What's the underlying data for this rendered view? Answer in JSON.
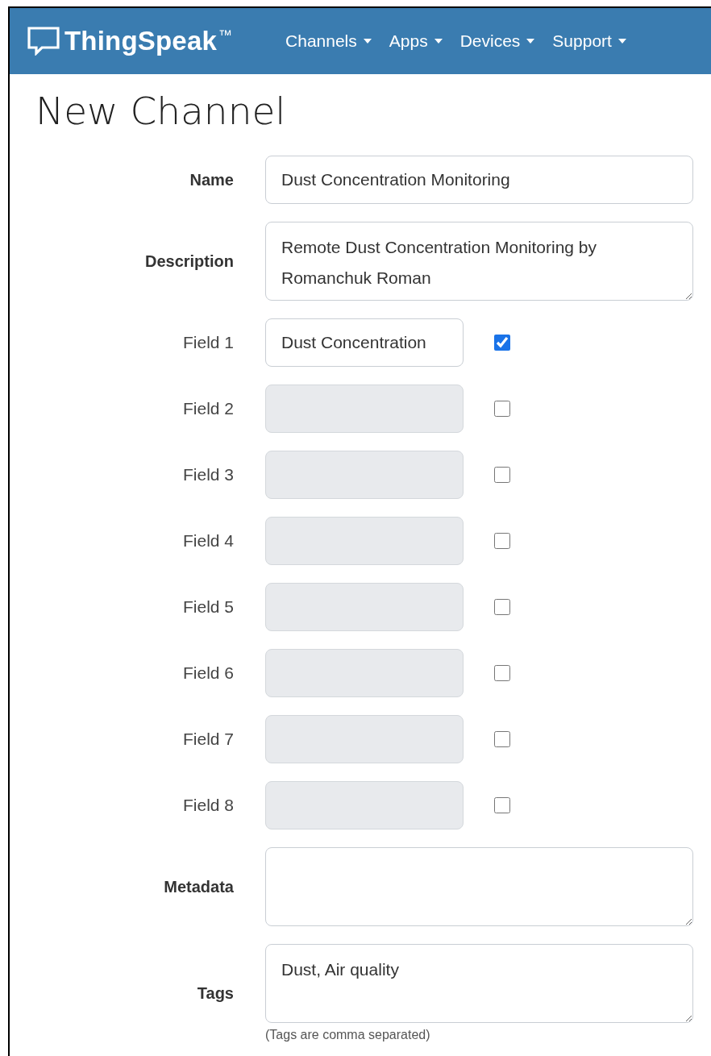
{
  "navbar": {
    "brand": "ThingSpeak",
    "trademark": "™",
    "items": [
      {
        "label": "Channels"
      },
      {
        "label": "Apps"
      },
      {
        "label": "Devices"
      },
      {
        "label": "Support"
      }
    ]
  },
  "page_title": "New Channel",
  "form": {
    "rows": [
      {
        "kind": "text",
        "label": "Name",
        "value": "Dust Concentration Monitoring"
      },
      {
        "kind": "textarea",
        "label": "Description",
        "value": "Remote Dust Concentration Monitoring by Romanchuk Roman"
      },
      {
        "kind": "field",
        "label": "Field 1",
        "value": "Dust Concentration",
        "disabled": false,
        "checked": true
      },
      {
        "kind": "field",
        "label": "Field 2",
        "disabled": true,
        "checked": false
      },
      {
        "kind": "field",
        "label": "Field 3",
        "disabled": true,
        "checked": false
      },
      {
        "kind": "field",
        "label": "Field 4",
        "disabled": true,
        "checked": false
      },
      {
        "kind": "field",
        "label": "Field 5",
        "disabled": true,
        "checked": false
      },
      {
        "kind": "field",
        "label": "Field 6",
        "disabled": true,
        "checked": false
      },
      {
        "kind": "field",
        "label": "Field 7",
        "disabled": true,
        "checked": false
      },
      {
        "kind": "field",
        "label": "Field 8",
        "disabled": true,
        "checked": false
      },
      {
        "kind": "textarea",
        "label": "Metadata"
      },
      {
        "kind": "textarea",
        "label": "Tags",
        "value": "Dust, Air quality",
        "help": "(Tags are comma separated)"
      }
    ]
  }
}
